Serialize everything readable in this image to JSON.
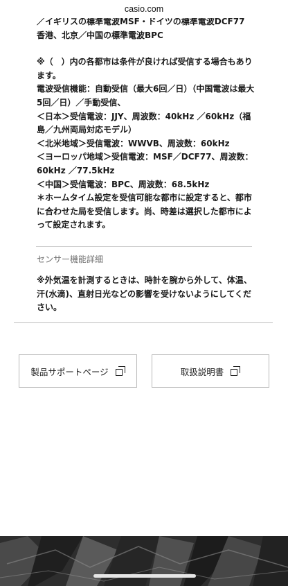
{
  "browser": {
    "url": "casio.com"
  },
  "reception": {
    "lines": [
      "／イギリスの標準電波MSF・ドイツの標準電波DCF77",
      "香港、北京／中国の標準電波BPC"
    ],
    "note_lines": [
      "※（　）内の各都市は条件が良ければ受信する場合もあります。",
      "電波受信機能：自動受信（最大6回／日）（中国電波は最大5回／日）／手動受信、",
      "＜日本＞受信電波：JJY、周波数：40kHz ／60kHz（福島／九州両局対応モデル）",
      "＜北米地域＞受信電波：WWVB、周波数：60kHz",
      "＜ヨーロッパ地域＞受信電波：MSF／DCF77、周波数：60kHz ／77.5kHz",
      "＜中国＞受信電波：BPC、周波数：68.5kHz",
      "＊ホームタイム設定を受信可能な都市に設定すると、都市に合わせた局を受信します。尚、時差は選択した都市によって設定されます。"
    ]
  },
  "sensor": {
    "heading": "センサー機能詳細",
    "note": "※外気温を計測するときは、時計を腕から外して、体温、汗(水滴)、直射日光などの影響を受けないようにしてください。"
  },
  "buttons": {
    "support_label": "製品サポートページ",
    "manual_label": "取扱説明書",
    "icon": "external-link-icon"
  },
  "colors": {
    "text": "#1a1a1a",
    "heading_gray": "#6d6d6d",
    "divider": "#cfcfcf",
    "footer": "#3a3a3a"
  }
}
